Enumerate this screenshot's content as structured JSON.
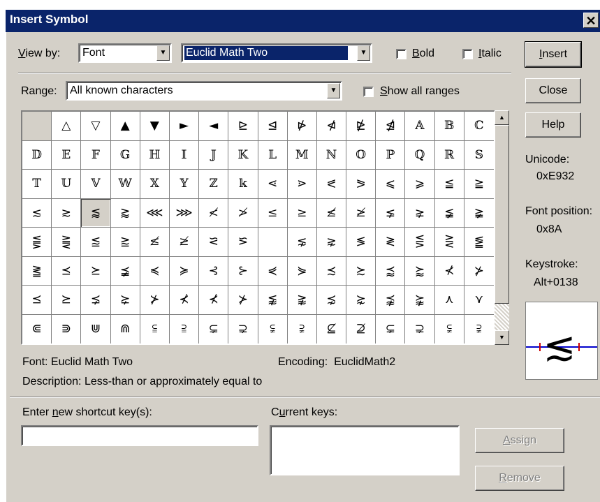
{
  "window": {
    "title": "Insert Symbol",
    "close_glyph": "✕"
  },
  "view_by": {
    "label": "View by:",
    "value": "Font"
  },
  "font_select": {
    "value": "Euclid Math Two"
  },
  "bold": {
    "label": "Bold",
    "checked": false
  },
  "italic": {
    "label": "Italic",
    "checked": false
  },
  "range": {
    "label": "Range:",
    "value": "All known characters"
  },
  "show_all_ranges": {
    "label": "Show all ranges",
    "checked": false
  },
  "buttons": {
    "insert": "Insert",
    "close": "Close",
    "help": "Help",
    "assign": "Assign",
    "remove": "Remove"
  },
  "info": {
    "unicode_label": "Unicode:",
    "unicode_value": "0xE932",
    "font_position_label": "Font position:",
    "font_position_value": "0x8A",
    "keystroke_label": "Keystroke:",
    "keystroke_value": "Alt+0138"
  },
  "status": {
    "font_label": "Font:",
    "font_value": "Euclid Math Two",
    "encoding_label": "Encoding:",
    "encoding_value": "EuclidMath2",
    "description_label": "Description:",
    "description_value": "Less-than or approximately equal to"
  },
  "shortcut": {
    "new_label": "Enter new shortcut key(s):",
    "new_value": "",
    "current_label": "Current keys:"
  },
  "preview_glyph": "≲",
  "selected_index": 50,
  "symbols": [
    "",
    "△",
    "▽",
    "▲",
    "▼",
    "►",
    "◄",
    "⊵",
    "⊴",
    "⋫",
    "⋪",
    "⋭",
    "⋬",
    "𝔸",
    "𝔹",
    "ℂ",
    "𝔻",
    "𝔼",
    "𝔽",
    "𝔾",
    "ℍ",
    "𝕀",
    "𝕁",
    "𝕂",
    "𝕃",
    "𝕄",
    "ℕ",
    "𝕆",
    "ℙ",
    "ℚ",
    "ℝ",
    "𝕊",
    "𝕋",
    "𝕌",
    "𝕍",
    "𝕎",
    "𝕏",
    "𝕐",
    "ℤ",
    "𝕜",
    "⋖",
    "⋗",
    "⪕",
    "⪖",
    "⩽",
    "⩾",
    "≦",
    "≧",
    "≲",
    "≳",
    "⪅",
    "⪆",
    "⋘",
    "⋙",
    "≮",
    "≯",
    "≤",
    "≥",
    "≰",
    "≱",
    "⪇",
    "⪈",
    "≨",
    "≩",
    "⪋",
    "⪌",
    "⪍",
    "⪎",
    "≰",
    "≱",
    "⪝",
    "⪞",
    " ",
    "⋦",
    "⋧",
    "≶",
    "≷",
    "⋚",
    "⋛",
    "⪑",
    "⪒",
    "⪯",
    "⪰",
    "⪵",
    "≼",
    "≽",
    "⊰",
    "⊱",
    "⋞",
    "⋟",
    "≾",
    "≿",
    "⪷",
    "⪸",
    "⊀",
    "⊁",
    "⪯",
    "⪰",
    "⪱",
    "⪲",
    "⊁",
    "⊀",
    "⊀",
    "⊁",
    "⪉",
    "⪊",
    "⋨",
    "⋩",
    "⪹",
    "⪺",
    "⋏",
    "⋎",
    "⋐",
    "⋑",
    "⋓",
    "⋒",
    "⫅",
    "⫆",
    "⊊",
    "⊋",
    "⫋",
    "⫌",
    "⊈",
    "⊉",
    "⊊",
    "⊋",
    "⫋",
    "⫌"
  ]
}
